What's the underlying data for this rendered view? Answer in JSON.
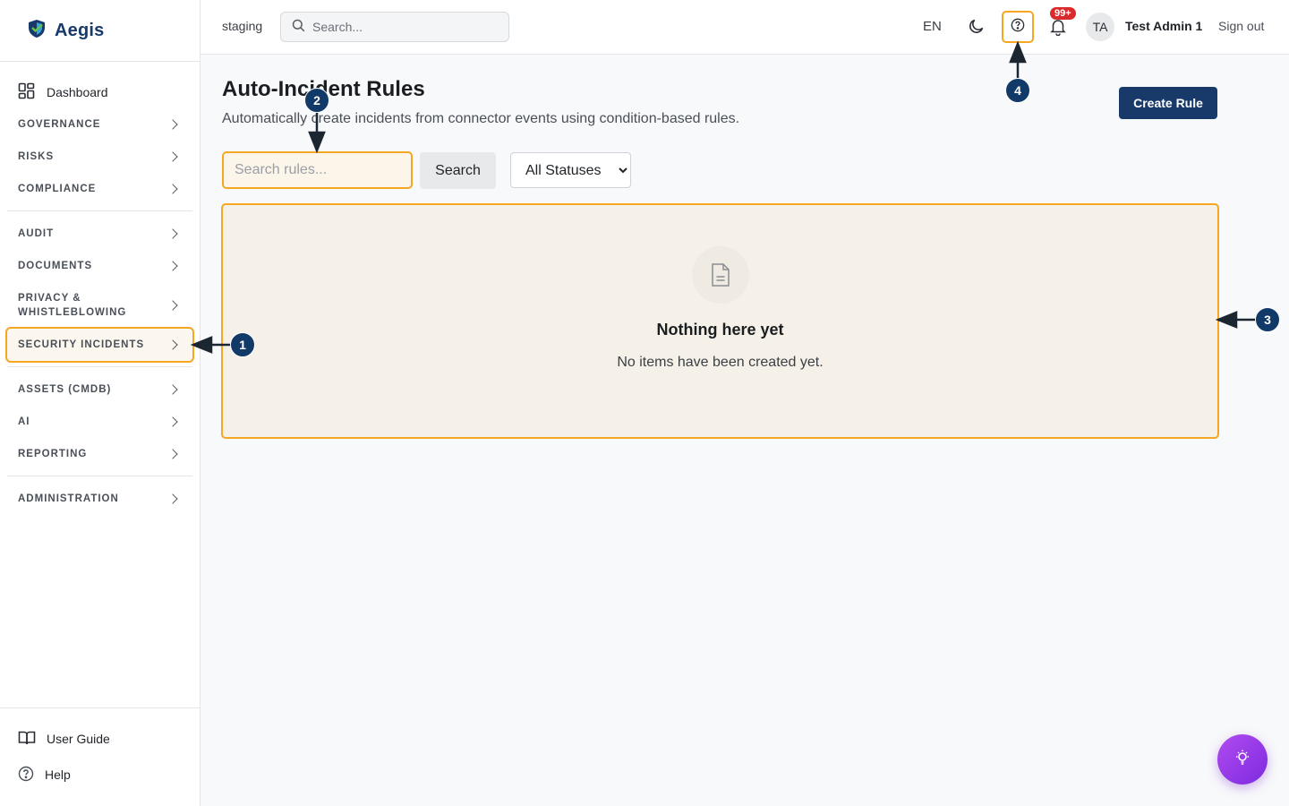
{
  "brand": {
    "name": "Aegis"
  },
  "topbar": {
    "environment": "staging",
    "search_placeholder": "Search...",
    "language": "EN",
    "notification_count": "99+",
    "avatar_initials": "TA",
    "user_name": "Test Admin 1",
    "sign_out": "Sign out"
  },
  "sidebar": {
    "dashboard": "Dashboard",
    "groups": [
      "GOVERNANCE",
      "RISKS",
      "COMPLIANCE",
      "AUDIT",
      "DOCUMENTS",
      "PRIVACY & WHISTLEBLOWING",
      "SECURITY INCIDENTS",
      "ASSETS (CMDB)",
      "AI",
      "REPORTING",
      "ADMINISTRATION"
    ],
    "user_guide": "User Guide",
    "help": "Help"
  },
  "main": {
    "title": "Auto-Incident Rules",
    "subtitle": "Automatically create incidents from connector events using condition-based rules.",
    "create_button": "Create Rule",
    "search_placeholder": "Search rules...",
    "search_button": "Search",
    "status_filter": {
      "selected": "All Statuses"
    },
    "empty_state": {
      "title": "Nothing here yet",
      "description": "No items have been created yet."
    }
  },
  "annotations": [
    "1",
    "2",
    "3",
    "4"
  ],
  "colors": {
    "brand": "#173a6b",
    "highlight": "#f5a623",
    "marker": "#123a68",
    "badge": "#d92b2b",
    "assistant": "#9b3fe8"
  },
  "icons": [
    "shield-logo-icon",
    "dashboard-grid-icon",
    "chevron-right-icon",
    "search-icon",
    "moon-icon",
    "help-circle-icon",
    "bell-icon",
    "document-icon",
    "book-open-icon",
    "lightbulb-icon"
  ]
}
